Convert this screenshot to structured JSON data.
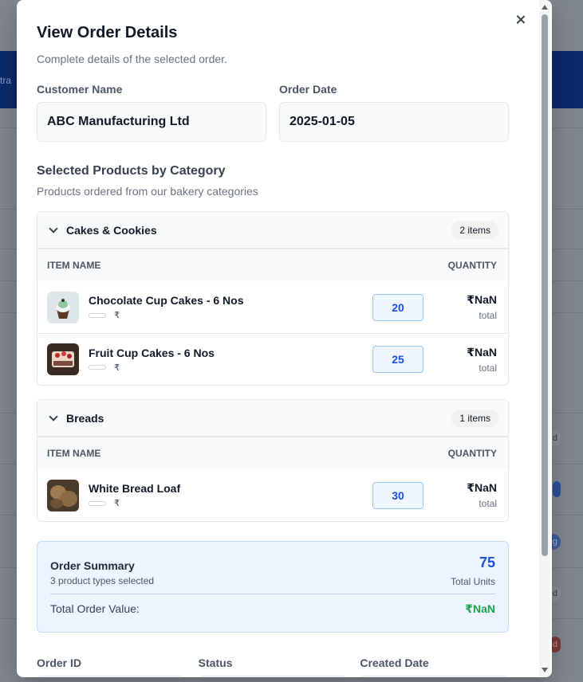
{
  "background": {
    "band_text": "tra",
    "pills": [
      "d",
      "",
      "ng",
      "ed",
      "d"
    ]
  },
  "modal": {
    "title": "View Order Details",
    "subtitle": "Complete details of the selected order.",
    "close_icon": "close-icon"
  },
  "fields": {
    "customer_label": "Customer Name",
    "customer_value": "ABC Manufacturing Ltd",
    "date_label": "Order Date",
    "date_value": "2025-01-05"
  },
  "products": {
    "title": "Selected Products by Category",
    "subtitle": "Products ordered from our bakery categories",
    "col_item": "ITEM NAME",
    "col_qty": "QUANTITY",
    "categories": [
      {
        "name": "Cakes & Cookies",
        "badge": "2 items",
        "items": [
          {
            "name": "Chocolate Cup Cakes - 6 Nos",
            "currency": "₹",
            "qty": "20",
            "price": "₹NaN",
            "price_sub": "total"
          },
          {
            "name": "Fruit Cup Cakes - 6 Nos",
            "currency": "₹",
            "qty": "25",
            "price": "₹NaN",
            "price_sub": "total"
          }
        ]
      },
      {
        "name": "Breads",
        "badge": "1 items",
        "items": [
          {
            "name": "White Bread Loaf",
            "currency": "₹",
            "qty": "30",
            "price": "₹NaN",
            "price_sub": "total"
          }
        ]
      }
    ]
  },
  "summary": {
    "title": "Order Summary",
    "subtitle": "3 product types selected",
    "units_value": "75",
    "units_label": "Total Units",
    "total_label": "Total Order Value:",
    "total_value": "₹NaN"
  },
  "meta": {
    "order_id_label": "Order ID",
    "status_label": "Status",
    "created_label": "Created Date"
  },
  "colors": {
    "accent": "#1d4ed8",
    "success": "#16a34a",
    "band": "#0b2a6b"
  }
}
